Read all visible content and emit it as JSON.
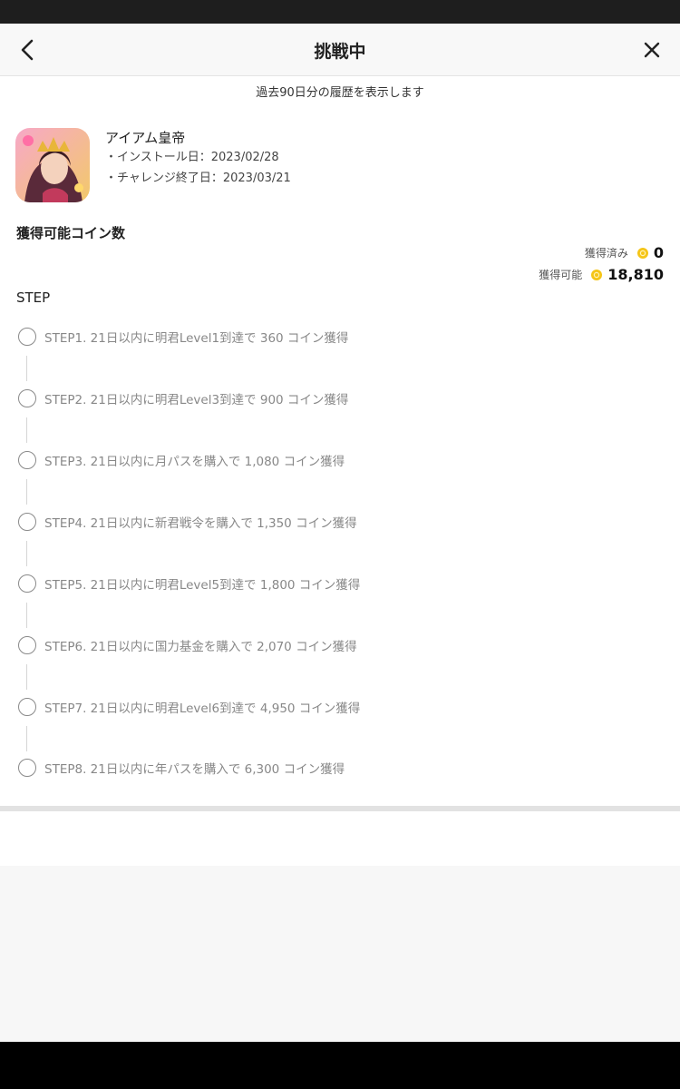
{
  "header": {
    "title": "挑戦中",
    "back_icon": "chevron-left-icon",
    "close_icon": "close-icon"
  },
  "history_note": "過去90日分の履歴を表示します",
  "app": {
    "name": "アイアム皇帝",
    "install_date": "・インストール日：2023/02/28",
    "end_date": "・チャレンジ終了日：2023/03/21"
  },
  "coins": {
    "heading": "獲得可能コイン数",
    "earned_label": "獲得済み",
    "earned_value": "0",
    "available_label": "獲得可能",
    "available_value": "18,810",
    "coin_color": "#f5c518"
  },
  "step_heading": "STEP",
  "steps": [
    "STEP1. 21日以内に明君Level1到達で 360 コイン獲得",
    "STEP2. 21日以内に明君Level3到達で 900 コイン獲得",
    "STEP3. 21日以内に月パスを購入で 1,080 コイン獲得",
    "STEP4. 21日以内に新君戦令を購入で 1,350 コイン獲得",
    "STEP5. 21日以内に明君Level5到達で 1,800 コイン獲得",
    "STEP6. 21日以内に国力基金を購入で 2,070 コイン獲得",
    "STEP7. 21日以内に明君Level6到達で 4,950 コイン獲得",
    "STEP8. 21日以内に年パスを購入で 6,300 コイン獲得"
  ]
}
